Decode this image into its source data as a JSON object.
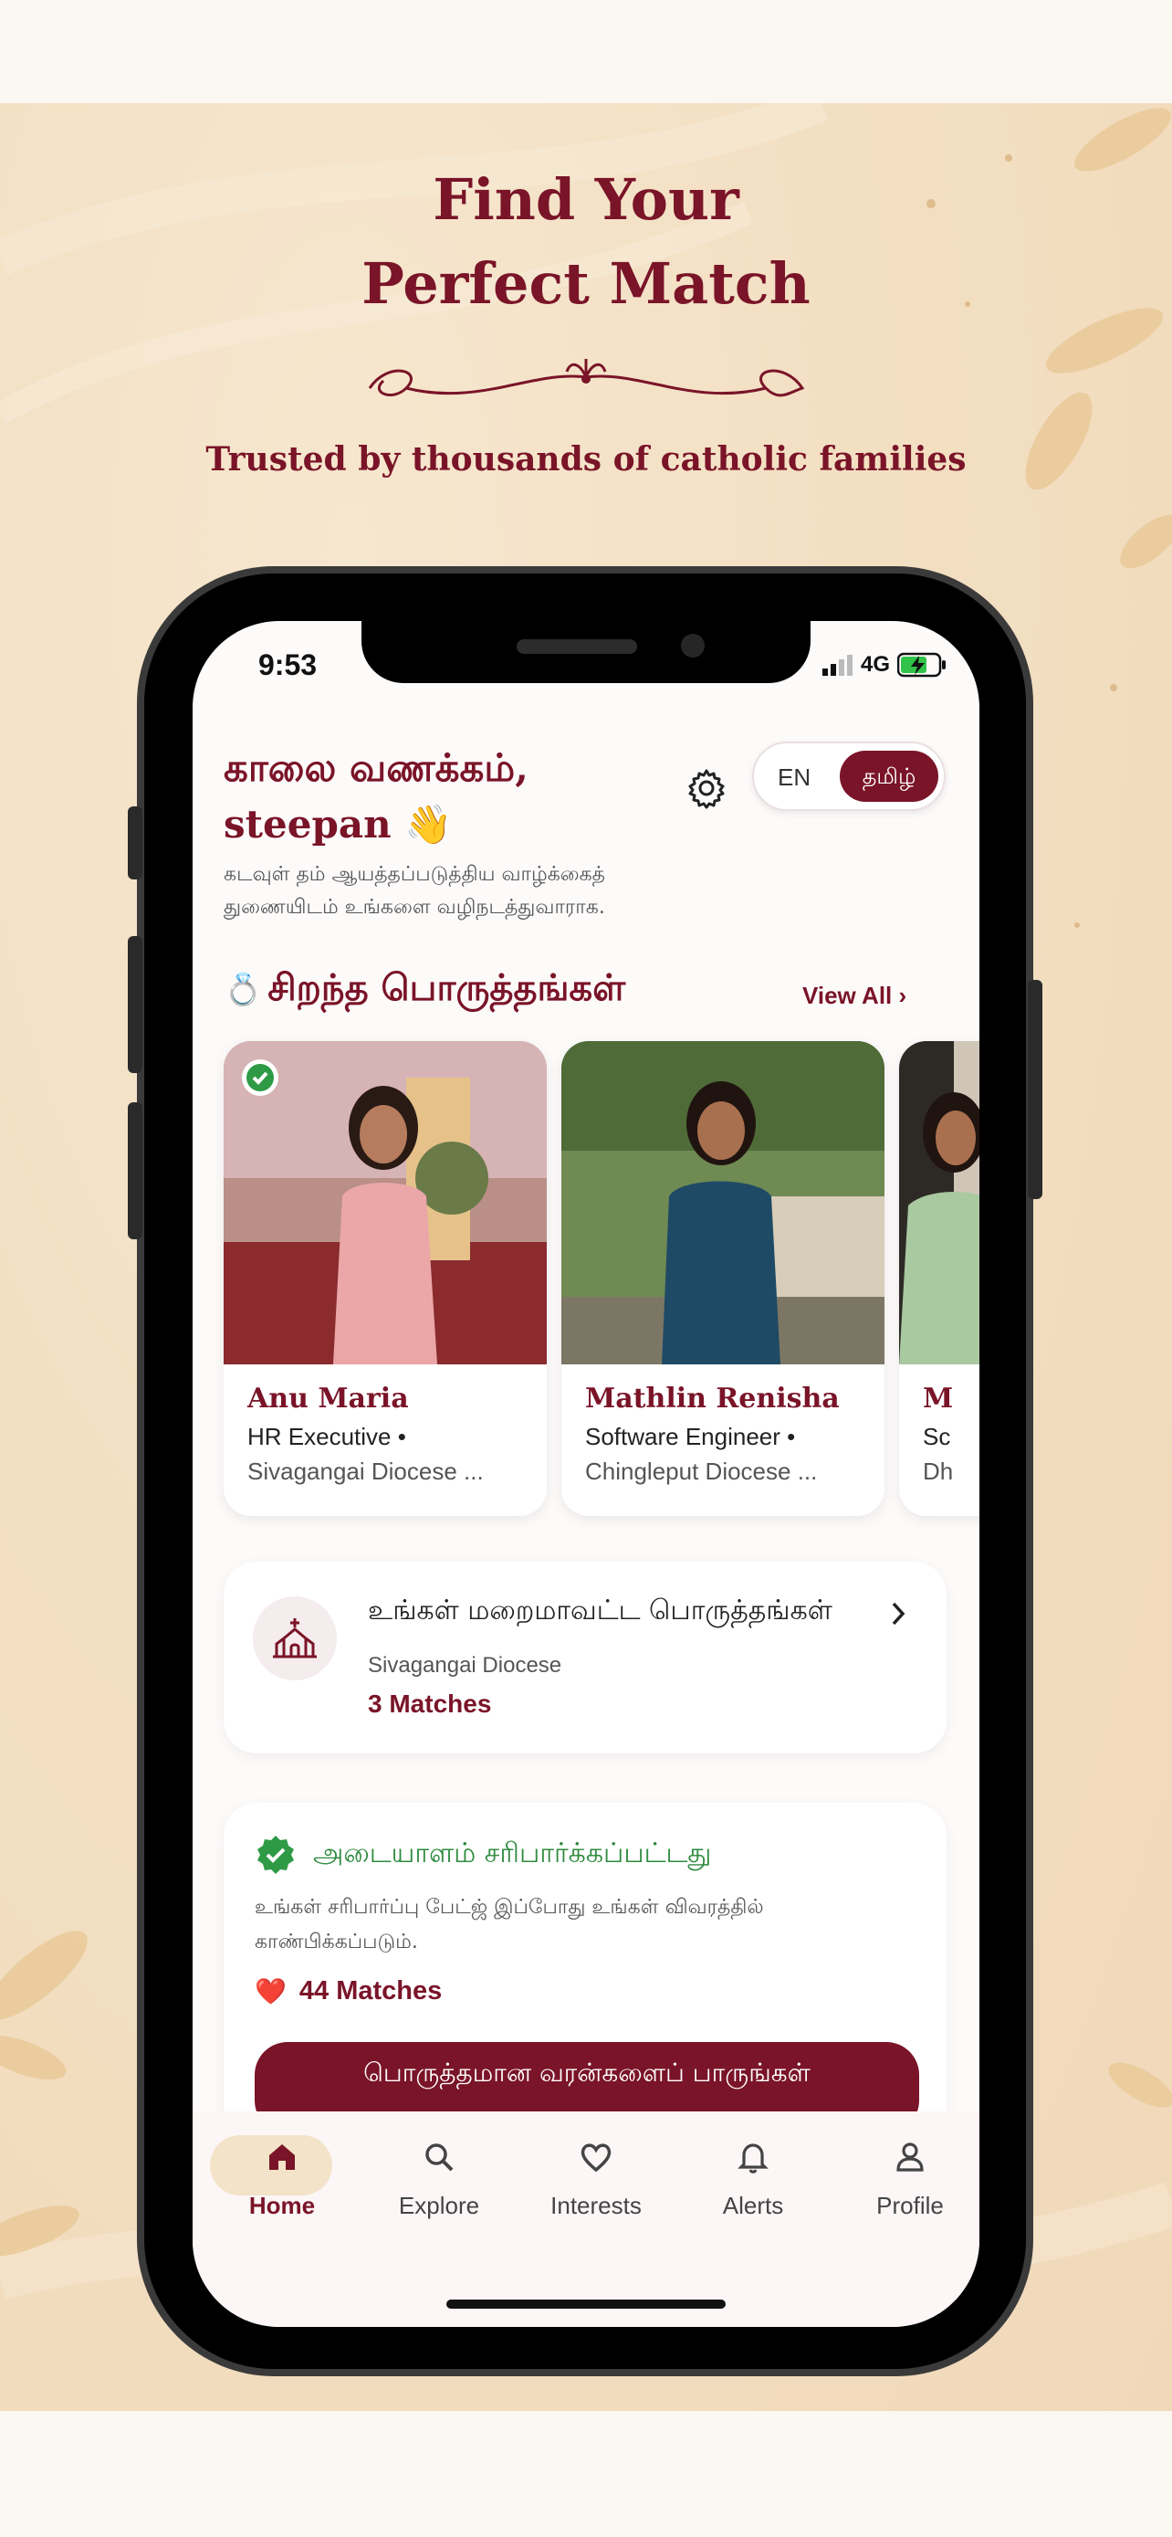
{
  "poster": {
    "headline_line1": "Find Your",
    "headline_line2": "Perfect Match",
    "tagline": "Trusted by thousands of catholic families"
  },
  "status_bar": {
    "time": "9:53",
    "network": "4G"
  },
  "header": {
    "greeting_line1": "காலை வணக்கம்,",
    "greeting_line2": "steepan 👋",
    "subtitle": "கடவுள் தம் ஆயத்தப்படுத்திய வாழ்க்கைத் துணையிடம் உங்களை வழிநடத்துவாராக.",
    "settings_icon": "gear-icon",
    "lang_en": "EN",
    "lang_ta": "தமிழ்"
  },
  "best_matches": {
    "title": "சிறந்த பொருத்தங்கள்",
    "ring_icon": "💍",
    "view_all": "View All ›",
    "profiles": [
      {
        "name": "Anu Maria",
        "job": "HR Executive  •",
        "location": "Sivagangai Diocese ...",
        "verified": true
      },
      {
        "name": "Mathlin Renisha",
        "job": "Software Engineer  •",
        "location": "Chingleput Diocese ...",
        "verified": false
      },
      {
        "name": "M",
        "job": "Sc",
        "location": "Dh",
        "verified": false
      }
    ]
  },
  "diocese_card": {
    "title": "உங்கள் மறைமாவட்ட பொருத்தங்கள்",
    "diocese": "Sivagangai Diocese",
    "count": "3 Matches",
    "icon": "church-icon"
  },
  "verification_card": {
    "title": "அடையாளம் சரிபார்க்கப்பட்டது",
    "subtitle": "உங்கள் சரிபார்ப்பு பேட்ஜ் இப்போது உங்கள் விவரத்தில் காண்பிக்கப்படும்.",
    "heart_icon": "❤️",
    "matches": "44 Matches",
    "cta": "பொருத்தமான வரன்களைப் பாருங்கள்"
  },
  "tabs": [
    {
      "label": "Home",
      "icon": "home-icon",
      "active": true
    },
    {
      "label": "Explore",
      "icon": "search-icon",
      "active": false
    },
    {
      "label": "Interests",
      "icon": "heart-icon",
      "active": false
    },
    {
      "label": "Alerts",
      "icon": "bell-icon",
      "active": false
    },
    {
      "label": "Profile",
      "icon": "person-icon",
      "active": false
    }
  ],
  "colors": {
    "brand": "#7a1428",
    "verified_green": "#2e8b3e",
    "poster_bg": "#f3dfc2",
    "active_tab": "#f3e3c8"
  }
}
